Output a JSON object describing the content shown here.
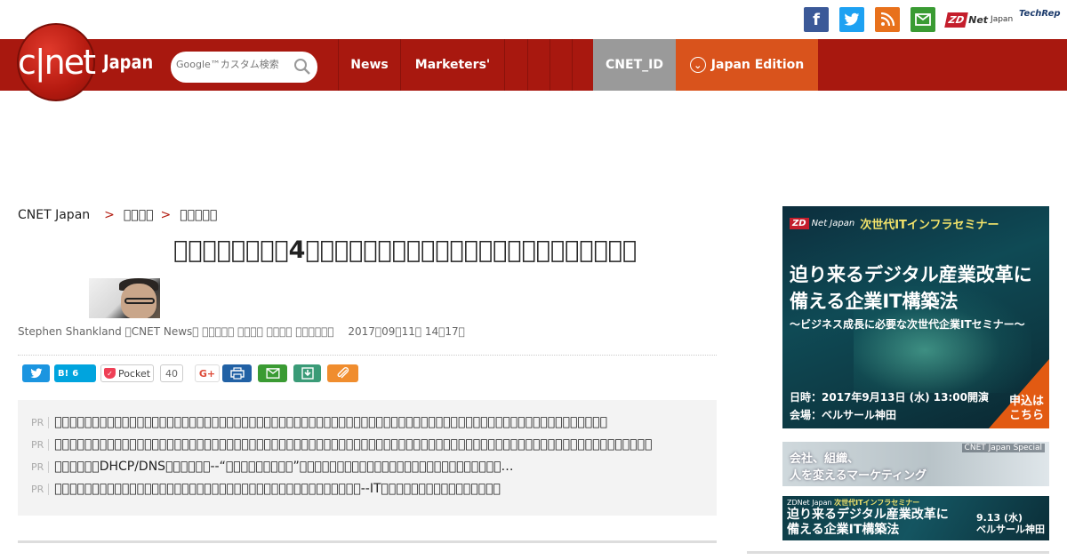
{
  "topbar": {
    "social": [
      {
        "name": "facebook-icon",
        "glyph": "f",
        "color": "#3b5998"
      },
      {
        "name": "twitter-icon",
        "glyph": "t",
        "color": "#1da1f2"
      },
      {
        "name": "rss-icon",
        "glyph": "rss",
        "color": "#e8711c"
      },
      {
        "name": "mail-icon",
        "glyph": "mail",
        "color": "#3a9b33"
      }
    ],
    "zdnet_badge": "ZD",
    "zdnet_text": "Net",
    "zdnet_sub": "Japan",
    "techrepublic": "TechRep"
  },
  "header": {
    "logo_text": "c|net",
    "logo_japan": "Japan",
    "search_placeholder": "Google™カスタム検索",
    "nav": {
      "news": "News",
      "marketers": "Marketers'",
      "cnet_id": "CNET_ID",
      "edition": "Japan Edition"
    },
    "brand_color": "#a8180f",
    "edition_color": "#d9531c"
  },
  "breadcrumb": {
    "root": "CNET Japan",
    "sep": ">",
    "level1": "\u0000\u0000\u0000\u0000",
    "level2": "\u0000\u0000\u0000\u0000\u0000"
  },
  "article": {
    "title": "\u0000\u0000\u0000\u0000\u0000\u0000\u0000\u00004\u0000\u0000\u0000\u0000\u0000\u0000\u0000\u0000\u0000\u0000\u0000\u0000\u0000\u0000\u0000\u0000\u0000\u0000\u0000\u0000\u0000\u0000\u0000",
    "byline": "Stephen Shankland \u0000CNET News\u0000 \u0000\u0000\u0000\u0000\u0000 \u0000\u0000\u0000\u0000 \u0000\u0000\u0000\u0000 \u0000\u0000\u0000\u0000\u0000\u0000　 2017\u000009\u000011\u0000 14\u000017\u0000"
  },
  "share": {
    "twitter": "t",
    "hatena": "B!",
    "hatena_count": "6",
    "pocket": "Pocket",
    "pocket_count": "40",
    "gplus": "G+"
  },
  "pr": {
    "tag": "PR",
    "items": [
      "\u0000\u0000\u0000\u0000\u0000\u0000\u0000\u0000\u0000\u0000\u0000\u0000\u0000\u0000\u0000\u0000\u0000\u0000\u0000\u0000\u0000\u0000\u0000\u0000\u0000\u0000\u0000\u0000\u0000\u0000\u0000\u0000\u0000\u0000\u0000\u0000\u0000\u0000\u0000\u0000\u0000\u0000\u0000\u0000\u0000\u0000\u0000\u0000\u0000\u0000\u0000\u0000\u0000\u0000\u0000\u0000\u0000\u0000\u0000\u0000\u0000\u0000\u0000\u0000\u0000\u0000\u0000\u0000\u0000\u0000\u0000\u0000\u0000\u0000",
      "\u0000\u0000\u0000\u0000\u0000\u0000\u0000\u0000\u0000\u0000\u0000\u0000\u0000\u0000\u0000\u0000\u0000\u0000\u0000\u0000\u0000\u0000\u0000\u0000\u0000\u0000\u0000\u0000\u0000\u0000\u0000\u0000\u0000\u0000\u0000\u0000\u0000\u0000\u0000\u0000\u0000\u0000\u0000\u0000\u0000\u0000\u0000\u0000\u0000\u0000\u0000\u0000\u0000\u0000\u0000\u0000\u0000\u0000\u0000\u0000\u0000\u0000\u0000\u0000\u0000\u0000\u0000\u0000\u0000\u0000\u0000\u0000\u0000\u0000\u0000\u0000\u0000\u0000\u0000\u0000",
      "\u0000\u0000\u0000\u0000\u0000\u0000DHCP/DNS\u0000\u0000\u0000\u0000\u0000\u0000--“\u0000\u0000\u0000\u0000\u0000\u0000\u0000\u0000\u0000”\u0000\u0000\u0000\u0000\u0000\u0000\u0000\u0000\u0000\u0000\u0000\u0000\u0000\u0000\u0000\u0000\u0000\u0000\u0000\u0000\u0000\u0000\u0000\u0000\u0000\u0000\u0000…",
      "\u0000\u0000\u0000\u0000\u0000\u0000\u0000\u0000\u0000\u0000\u0000\u0000\u0000\u0000\u0000\u0000\u0000\u0000\u0000\u0000\u0000\u0000\u0000\u0000\u0000\u0000\u0000\u0000\u0000\u0000\u0000\u0000\u0000\u0000\u0000\u0000\u0000\u0000\u0000\u0000\u0000--IT\u0000\u0000\u0000\u0000\u0000\u0000\u0000\u0000\u0000\u0000\u0000\u0000\u0000\u0000\u0000\u0000"
    ]
  },
  "ads": {
    "main": {
      "brand": "ZD",
      "brand_sub": "Net Japan",
      "heading": "次世代ITインフラセミナー",
      "line1": "迫り来るデジタル産業改革に",
      "line2": "備える企業IT構築法",
      "sub": "〜ビジネス成長に必要な次世代企業ITセミナー〜",
      "date": "日時：2017年9月13日 (水) 13:00開演",
      "venue": "会場：ベルサール神田",
      "cta1": "申込は",
      "cta2": "こちら"
    },
    "second": {
      "tag": "CNET Japan Special",
      "line1": "会社、組織、",
      "line2": "人を変えるマーケティング"
    },
    "third": {
      "brand": "ZDNet Japan",
      "heading": "次世代ITインフラセミナー",
      "line1": "迫り来るデジタル産業改革に",
      "line2": "備える企業IT構築法",
      "date": "9.13 (水)",
      "venue": "ベルサール神田"
    }
  }
}
